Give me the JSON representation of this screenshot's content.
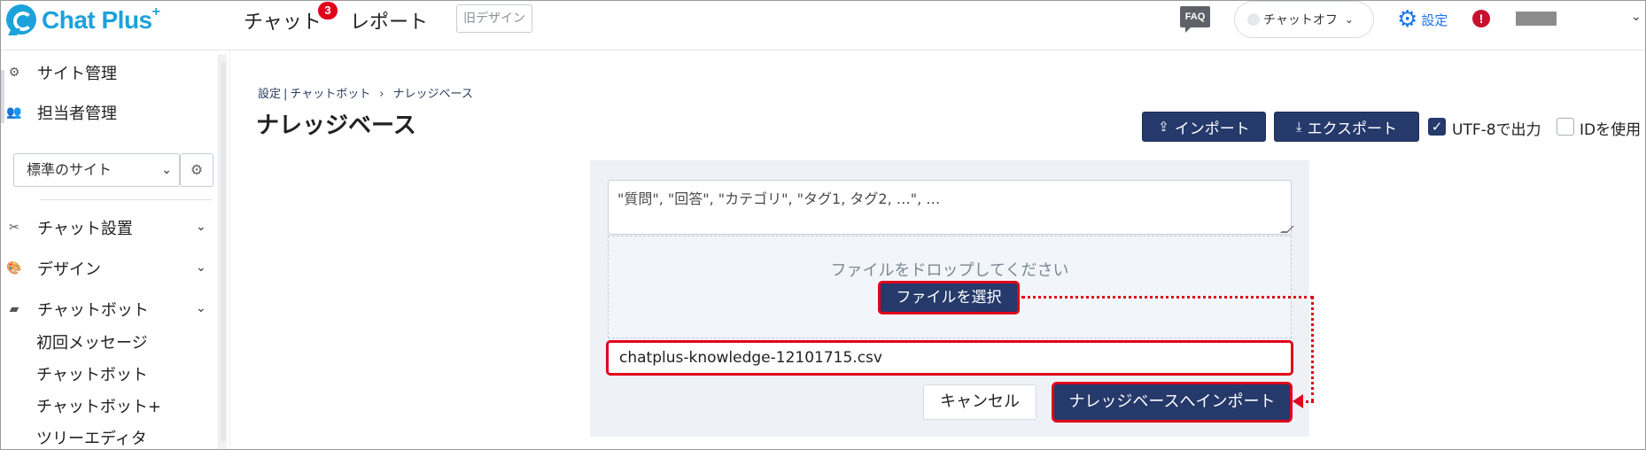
{
  "header": {
    "logo_text": "Chat Plus",
    "logo_plus": "+",
    "nav_chat": "チャット",
    "nav_chat_badge": "3",
    "nav_report": "レポート",
    "old_design": "旧デザイン",
    "faq": "FAQ",
    "status": "チャットオフ",
    "settings": "設定",
    "alert": "!"
  },
  "sidebar": {
    "items": [
      {
        "label": "サイト管理",
        "icon": "gear-icon"
      },
      {
        "label": "担当者管理",
        "icon": "users-icon"
      }
    ],
    "site_select": "標準のサイト",
    "sections": [
      {
        "label": "チャット設置",
        "icon": "tools-icon"
      },
      {
        "label": "デザイン",
        "icon": "palette-icon"
      },
      {
        "label": "チャットボット",
        "icon": "chat-bubble-icon"
      }
    ],
    "sub_items": [
      "初回メッセージ",
      "チャットボット",
      "チャットボット+",
      "ツリーエディタ"
    ]
  },
  "main": {
    "breadcrumb": [
      "設定",
      "チャットボット",
      "ナレッジベース"
    ],
    "breadcrumb_bar": "|",
    "breadcrumb_arrow": "›",
    "title": "ナレッジベース",
    "import_label": "インポート",
    "export_label": "エクスポート",
    "utf8_label": "UTF-8で出力",
    "utf8_checked": true,
    "id_label": "IDを使用",
    "id_checked": false,
    "csv_placeholder": "\"質問\", \"回答\", \"カテゴリ\", \"タグ1, タグ2, …\", …",
    "drop_text": "ファイルをドロップしてください",
    "select_file": "ファイルを選択",
    "file_name": "chatplus-knowledge-12101715.csv",
    "cancel": "キャンセル",
    "submit": "ナレッジベースへインポート"
  },
  "colors": {
    "brand": "#1ba2da",
    "primary_button": "#25396b",
    "highlight": "#e0001a",
    "link": "#1a73e8"
  }
}
